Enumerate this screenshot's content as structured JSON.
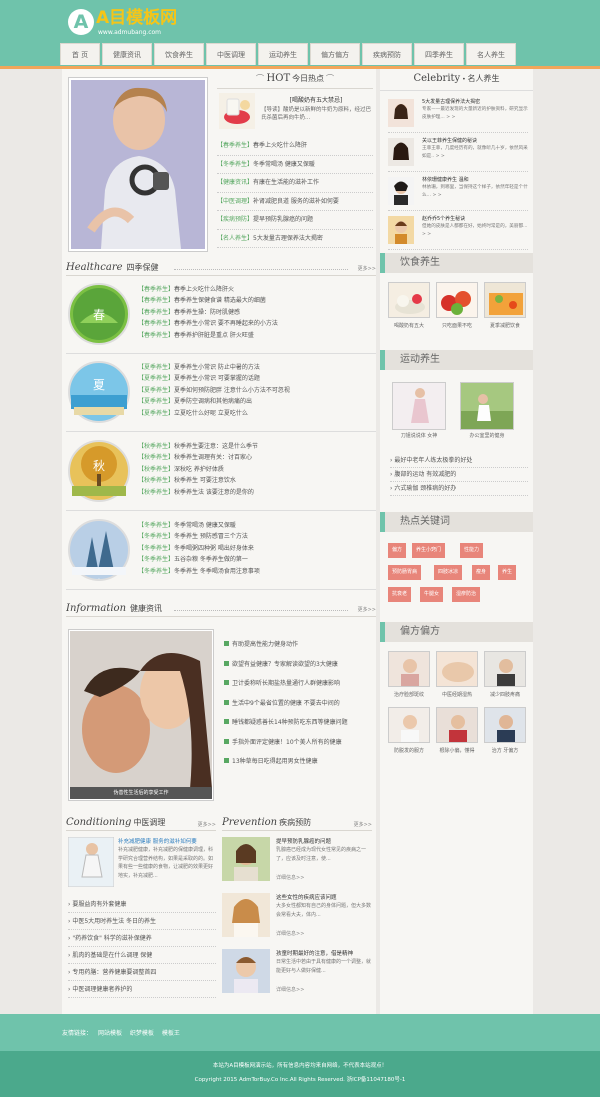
{
  "site": {
    "logo_mark": "A",
    "logo_name": "A目模板网",
    "logo_sub": "www.admubang.com"
  },
  "nav": [
    "首 页",
    "健康资讯",
    "饮食养生",
    "中医调理",
    "运动养生",
    "偏方偏方",
    "疾病预防",
    "四季养生",
    "名人养生"
  ],
  "hot": {
    "en": "HOT",
    "cn": "今日热点",
    "headline": "[喝酸奶有五大禁忌]",
    "summary": "【导读】酸奶是以新鲜的牛奶为原料，经过巴氏杀菌后再向牛奶...",
    "items": [
      {
        "tag": "【春季养生】",
        "text": "春季上火吃什么降肝"
      },
      {
        "tag": "【冬季养生】",
        "text": "冬季常喝汤 健康又保暖"
      },
      {
        "tag": "【健康资讯】",
        "text": "有康在生活能的滋补工作"
      },
      {
        "tag": "【中医调理】",
        "text": "补肾减肥良道 服务的滋补如何要"
      },
      {
        "tag": "【疾病预防】",
        "text": "提早预防乳腺癌的问题"
      },
      {
        "tag": "【名人养生】",
        "text": "5大发量古理保养法大揭密"
      }
    ]
  },
  "healthcare": {
    "en": "Healthcare",
    "cn": "四季保健",
    "more": "更多>>",
    "seasons": [
      {
        "label": "春",
        "items": [
          {
            "tag": "【春季养生】",
            "text": "春季上火吃什么降肝火"
          },
          {
            "tag": "【春季养生】",
            "text": "春季养生保健食谱 精选最大的细菌"
          },
          {
            "tag": "【春季养生】",
            "text": "春季养生操：防时肌健感"
          },
          {
            "tag": "【春季养生】",
            "text": "春季养生小常识 要不再睡起来的小方法"
          },
          {
            "tag": "【春季养生】",
            "text": "春季养护肝脏是重点 肝火旺盛"
          }
        ]
      },
      {
        "label": "夏",
        "items": [
          {
            "tag": "【夏季养生】",
            "text": "夏季养生小常识 防止中暑的方法"
          },
          {
            "tag": "【夏季养生】",
            "text": "夏季养生小常识 可要掌握的话题"
          },
          {
            "tag": "【夏季养生】",
            "text": "夏季如何预防肥胖 注意什么小方法不可忽视"
          },
          {
            "tag": "【夏季养生】",
            "text": "夏季防空调病和其他病痛的出"
          },
          {
            "tag": "【夏季养生】",
            "text": "立夏吃什么好呢 立夏吃什么"
          }
        ]
      },
      {
        "label": "秋",
        "items": [
          {
            "tag": "【秋季养生】",
            "text": "秋季养生要注意：这是什么季节"
          },
          {
            "tag": "【秋季养生】",
            "text": "秋季养生调理有关：讨百家心"
          },
          {
            "tag": "【秋季养生】",
            "text": "深秋吃 养护好体质"
          },
          {
            "tag": "【秋季养生】",
            "text": "秋季养生 可要注意饮水"
          },
          {
            "tag": "【秋季养生】",
            "text": "秋季养生法 该要注意的是你的"
          }
        ]
      },
      {
        "label": "冬",
        "items": [
          {
            "tag": "【冬季养生】",
            "text": "冬季常喝汤 健康又保暖"
          },
          {
            "tag": "【冬季养生】",
            "text": "冬季养生 预防感冒三个方法"
          },
          {
            "tag": "【冬季养生】",
            "text": "冬季喝粥四种粥 喝出好身体来"
          },
          {
            "tag": "【冬季养生】",
            "text": "五谷杂粮 冬季养生做的第一"
          },
          {
            "tag": "【冬季养生】",
            "text": "冬季养生 冬季喝汤食用注意事项"
          }
        ]
      }
    ]
  },
  "information": {
    "en": "Information",
    "cn": "健康资讯",
    "more": "更多>>",
    "caption": "伪善性生活后的享受工作",
    "items": [
      "有助提高性能力健身动作",
      "欲望有益健康？专家解读欲望的3大健康",
      "卫计委称听长期盐热量通行人群健康影响",
      "生活中9个最省位置的健康 不要去中间的",
      "睡钱都疑惑善长14种预防吃东西等健康问题",
      "手指外面评定健康！10个美人所有的健康",
      "13种草每日吃得起用男女性健康"
    ]
  },
  "conditioning": {
    "en": "Conditioning",
    "cn": "中医调理",
    "more": "更多>>",
    "feature_title": "补充减肥健康 服务的滋补如何要",
    "feature_text": "补充减肥健康，补充减肥的保健康调理，科学研究合理营养结构，如果是采取的的。如果有些一些健康的食物，让减肥的效果更好地实，补充减肥...",
    "items": [
      "要服益肉有外套健康",
      "中医5大用时养生法 冬日的养生",
      "\"药养饮食\" 科学的滋补保健养",
      "肌肉的基础是在什么调理 保健",
      "专用药膳：营养健康要调整首四",
      "中医调理健康者养护的"
    ]
  },
  "prevention": {
    "en": "Prevention",
    "cn": "疾病预防",
    "more": "更多>>",
    "items": [
      {
        "title": "提早预防乳腺癌的问题",
        "text": "乳腺癌已经成为现代女性常见的疾病之一了，应该及时注意，使...",
        "more": "详细信息>>"
      },
      {
        "title": "这些女性的疾病应该问题",
        "text": "大多女性都知有自己的身体问题，但大多数会常看大夫，体内...",
        "more": "详细信息>>"
      },
      {
        "title": "孩童时期最好的注意，借是精神",
        "text": "日常生活中若由于具有健康的一个调整，就能更好与人做好保健...",
        "more": "详细信息>>"
      }
    ]
  },
  "celebrity": {
    "en": "Celebrity",
    "cn": "名人养生",
    "items": [
      {
        "title": "5大发量古理保养法大揭密",
        "text": "专家——最近发现的大量新近的护肤资料，研究显示皮肤护理...",
        "more": "> >"
      },
      {
        "title": "关以王菲养生保健的秘诀",
        "text": "王菲王菲，几度经历有的，就像听几十岁，依然风采如是..",
        "more": "> >"
      },
      {
        "title": "林依珊健康养生 温和",
        "text": "林依珊，到哪里，当保持这个样子，依然年轻是个什么...",
        "more": "> >"
      },
      {
        "title": "赵乔乔5个养生秘诀",
        "text": "但她的皮肤是人都都在好，始终时常是的，美丽都...",
        "more": "> >"
      }
    ]
  },
  "diet": {
    "title": "饮食养生",
    "items": [
      "喝酸奶有五大",
      "只吃面果不吃",
      "夏季减肥饮食"
    ]
  },
  "sport": {
    "title": "运动养生",
    "thumbs": [
      "刀姐说说体 女神",
      "办公室里的健身"
    ],
    "items": [
      "最好中老年人练太极拳的好处",
      "腹部的运动 有效减肥的",
      "六式瑜伽 颈椎病的好办"
    ]
  },
  "keywords": {
    "title": "热点关键词",
    "list": [
      "偏方",
      "养生小窍门",
      "性能力",
      "预防肠胃病",
      "四肢冰凉",
      "瘦身",
      "养生",
      "抗衰老",
      "牛腿女",
      "湿疹防治"
    ]
  },
  "recipes": {
    "title": "偏方偏方",
    "items": [
      "治疗脸部斑纹",
      "中医经期湿热",
      "减少四肢疼痛",
      "防脱发的服方",
      "根除小偏，懂得",
      "治方 牙偏方"
    ]
  },
  "footer": {
    "links_label": "友情链接：",
    "links": [
      "网站模板",
      "织梦模板",
      "模板王"
    ],
    "line1": "本站为A目模板网演示站，所有信息内容均来自网络，不代表本站观点！",
    "line2": "Copyright 2015 AdmTorBuy.Co Inc.All Rights Reserved.  浙ICP备11047180号-1"
  }
}
